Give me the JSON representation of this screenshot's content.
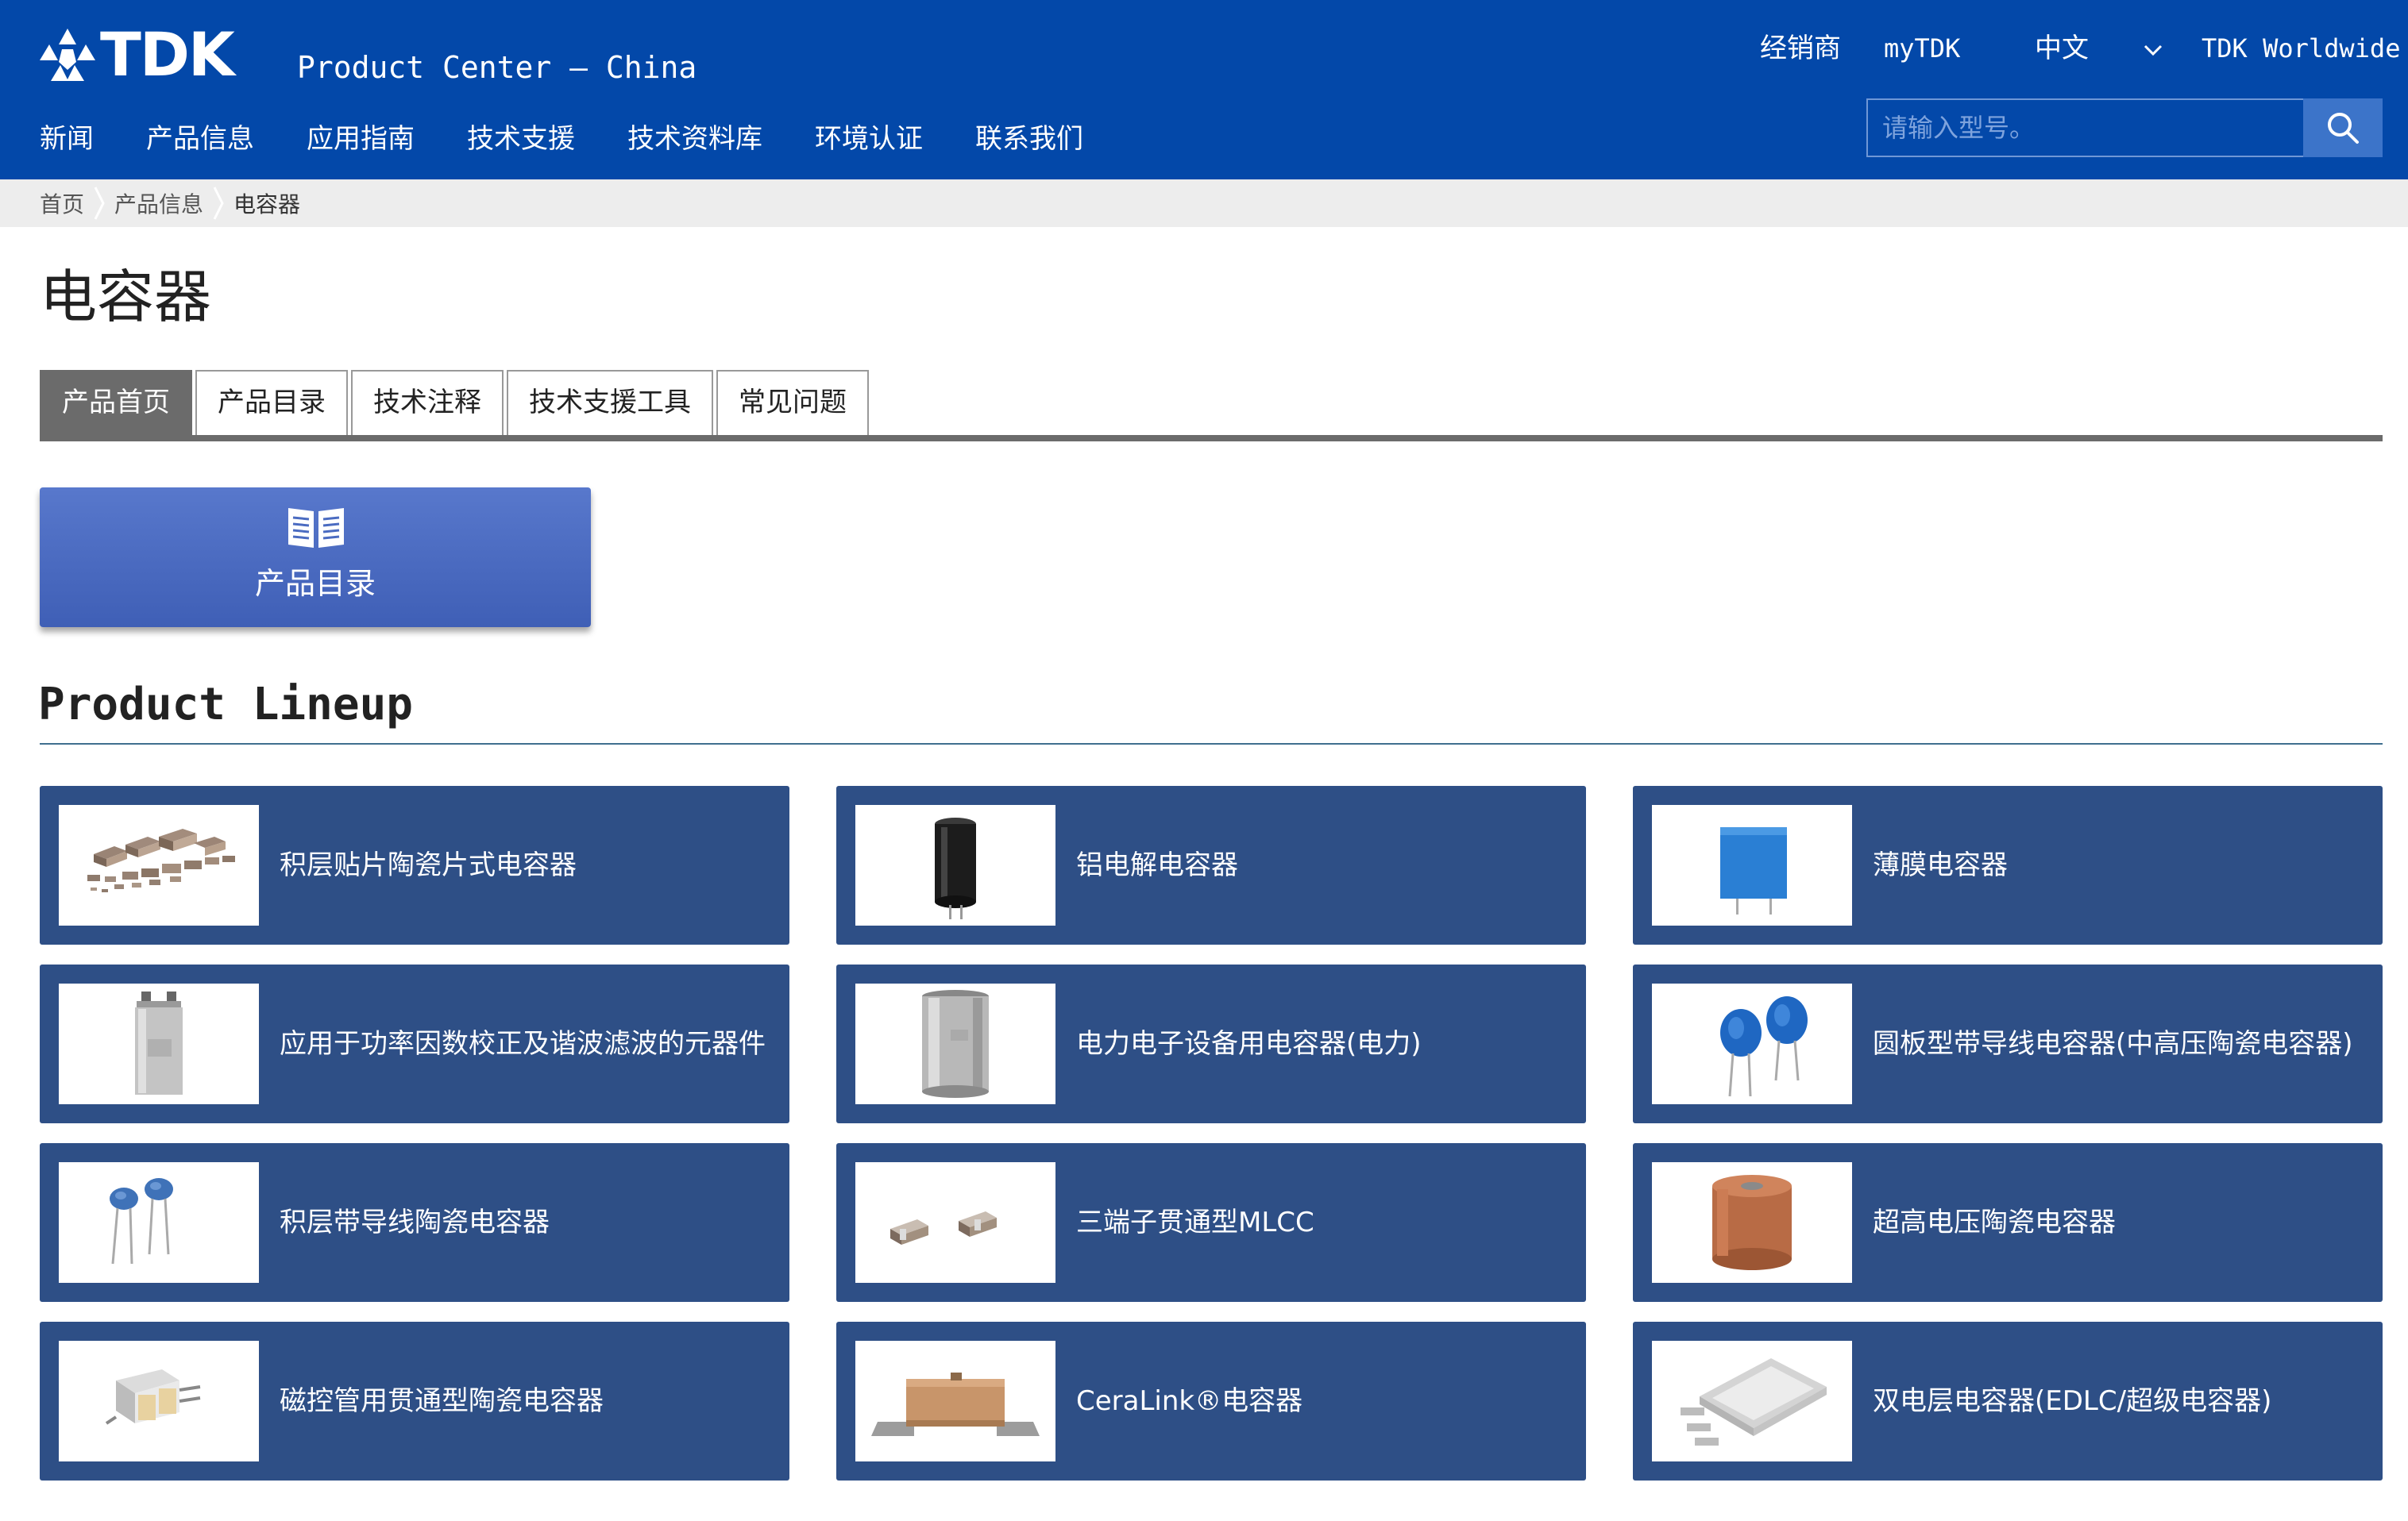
{
  "colors": {
    "header_bg": "#0348a9",
    "card_bg": "#2e4f86",
    "catalog_button_bg": "#4a6bc1",
    "tab_active_bg": "#6b6b6b",
    "breadcrumb_bg": "#ededed"
  },
  "header": {
    "logo_text": "TDK",
    "site_title": "Product Center – China",
    "utility": {
      "distributor": "经销商",
      "mytdk": "myTDK",
      "language": "中文",
      "worldwide": "TDK Worldwide",
      "language_icon": "chevron-down-icon"
    },
    "nav": [
      "新闻",
      "产品信息",
      "应用指南",
      "技术支援",
      "技术资料库",
      "环境认证",
      "联系我们"
    ],
    "search": {
      "placeholder": "请输入型号。",
      "value": "",
      "icon": "search-icon"
    }
  },
  "breadcrumb": [
    "首页",
    "产品信息",
    "电容器"
  ],
  "page": {
    "title": "电容器",
    "tabs": [
      {
        "label": "产品首页",
        "active": true
      },
      {
        "label": "产品目录",
        "active": false
      },
      {
        "label": "技术注释",
        "active": false
      },
      {
        "label": "技术支援工具",
        "active": false
      },
      {
        "label": "常见问题",
        "active": false
      }
    ],
    "catalog_button": {
      "label": "产品目录",
      "icon": "book-icon"
    }
  },
  "lineup": {
    "title": "Product Lineup",
    "items": [
      {
        "label": "积层贴片陶瓷片式电容器",
        "image": "mlcc-chips"
      },
      {
        "label": "铝电解电容器",
        "image": "aluminum-electrolytic"
      },
      {
        "label": "薄膜电容器",
        "image": "film-capacitor"
      },
      {
        "label": "应用于功率因数校正及谐波滤波的元器件",
        "image": "pfc-capacitor"
      },
      {
        "label": "电力电子设备用电容器(电力)",
        "image": "power-capacitor"
      },
      {
        "label": "圆板型带导线电容器(中高压陶瓷电容器)",
        "image": "disc-leaded"
      },
      {
        "label": "积层带导线陶瓷电容器",
        "image": "leaded-mlcc"
      },
      {
        "label": "三端子贯通型MLCC",
        "image": "feedthrough-mlcc"
      },
      {
        "label": "超高电压陶瓷电容器",
        "image": "uhv-ceramic"
      },
      {
        "label": "磁控管用贯通型陶瓷电容器",
        "image": "magnetron-feedthrough"
      },
      {
        "label": "CeraLink®电容器",
        "image": "ceralink"
      },
      {
        "label": "双电层电容器(EDLC/超级电容器)",
        "image": "edlc"
      }
    ]
  }
}
